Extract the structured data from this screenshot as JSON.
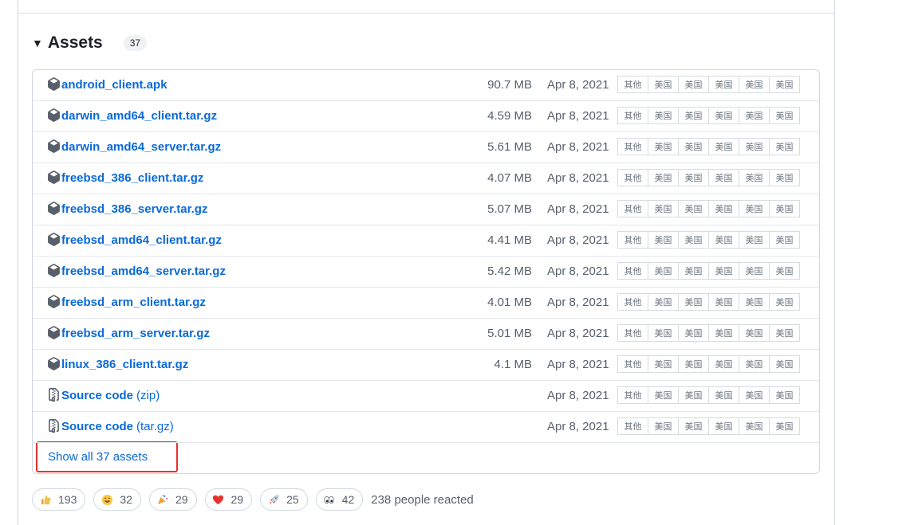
{
  "assets": {
    "title": "Assets",
    "count": "37",
    "files": [
      {
        "name": "android_client.apk",
        "size": "90.7 MB",
        "date": "Apr 8, 2021"
      },
      {
        "name": "darwin_amd64_client.tar.gz",
        "size": "4.59 MB",
        "date": "Apr 8, 2021"
      },
      {
        "name": "darwin_amd64_server.tar.gz",
        "size": "5.61 MB",
        "date": "Apr 8, 2021"
      },
      {
        "name": "freebsd_386_client.tar.gz",
        "size": "4.07 MB",
        "date": "Apr 8, 2021"
      },
      {
        "name": "freebsd_386_server.tar.gz",
        "size": "5.07 MB",
        "date": "Apr 8, 2021"
      },
      {
        "name": "freebsd_amd64_client.tar.gz",
        "size": "4.41 MB",
        "date": "Apr 8, 2021"
      },
      {
        "name": "freebsd_amd64_server.tar.gz",
        "size": "5.42 MB",
        "date": "Apr 8, 2021"
      },
      {
        "name": "freebsd_arm_client.tar.gz",
        "size": "4.01 MB",
        "date": "Apr 8, 2021"
      },
      {
        "name": "freebsd_arm_server.tar.gz",
        "size": "5.01 MB",
        "date": "Apr 8, 2021"
      },
      {
        "name": "linux_386_client.tar.gz",
        "size": "4.1 MB",
        "date": "Apr 8, 2021"
      }
    ],
    "source": [
      {
        "name": "Source code",
        "ext": "(zip)",
        "date": "Apr 8, 2021"
      },
      {
        "name": "Source code",
        "ext": "(tar.gz)",
        "date": "Apr 8, 2021"
      }
    ],
    "mirror_labels": [
      "其他",
      "美国",
      "美国",
      "美国",
      "美国",
      "美国"
    ],
    "show_all": "Show all 37 assets"
  },
  "reactions": {
    "items": [
      {
        "icon": "thumbs-up-icon",
        "count": "193"
      },
      {
        "icon": "laugh-icon",
        "count": "32"
      },
      {
        "icon": "hooray-icon",
        "count": "29"
      },
      {
        "icon": "heart-icon",
        "count": "29"
      },
      {
        "icon": "rocket-icon",
        "count": "25"
      },
      {
        "icon": "eyes-icon",
        "count": "42"
      }
    ],
    "summary": "238 people reacted"
  },
  "colors": {
    "link": "#0969da",
    "highlight_border": "#e5322d",
    "muted_text": "#57606a"
  }
}
